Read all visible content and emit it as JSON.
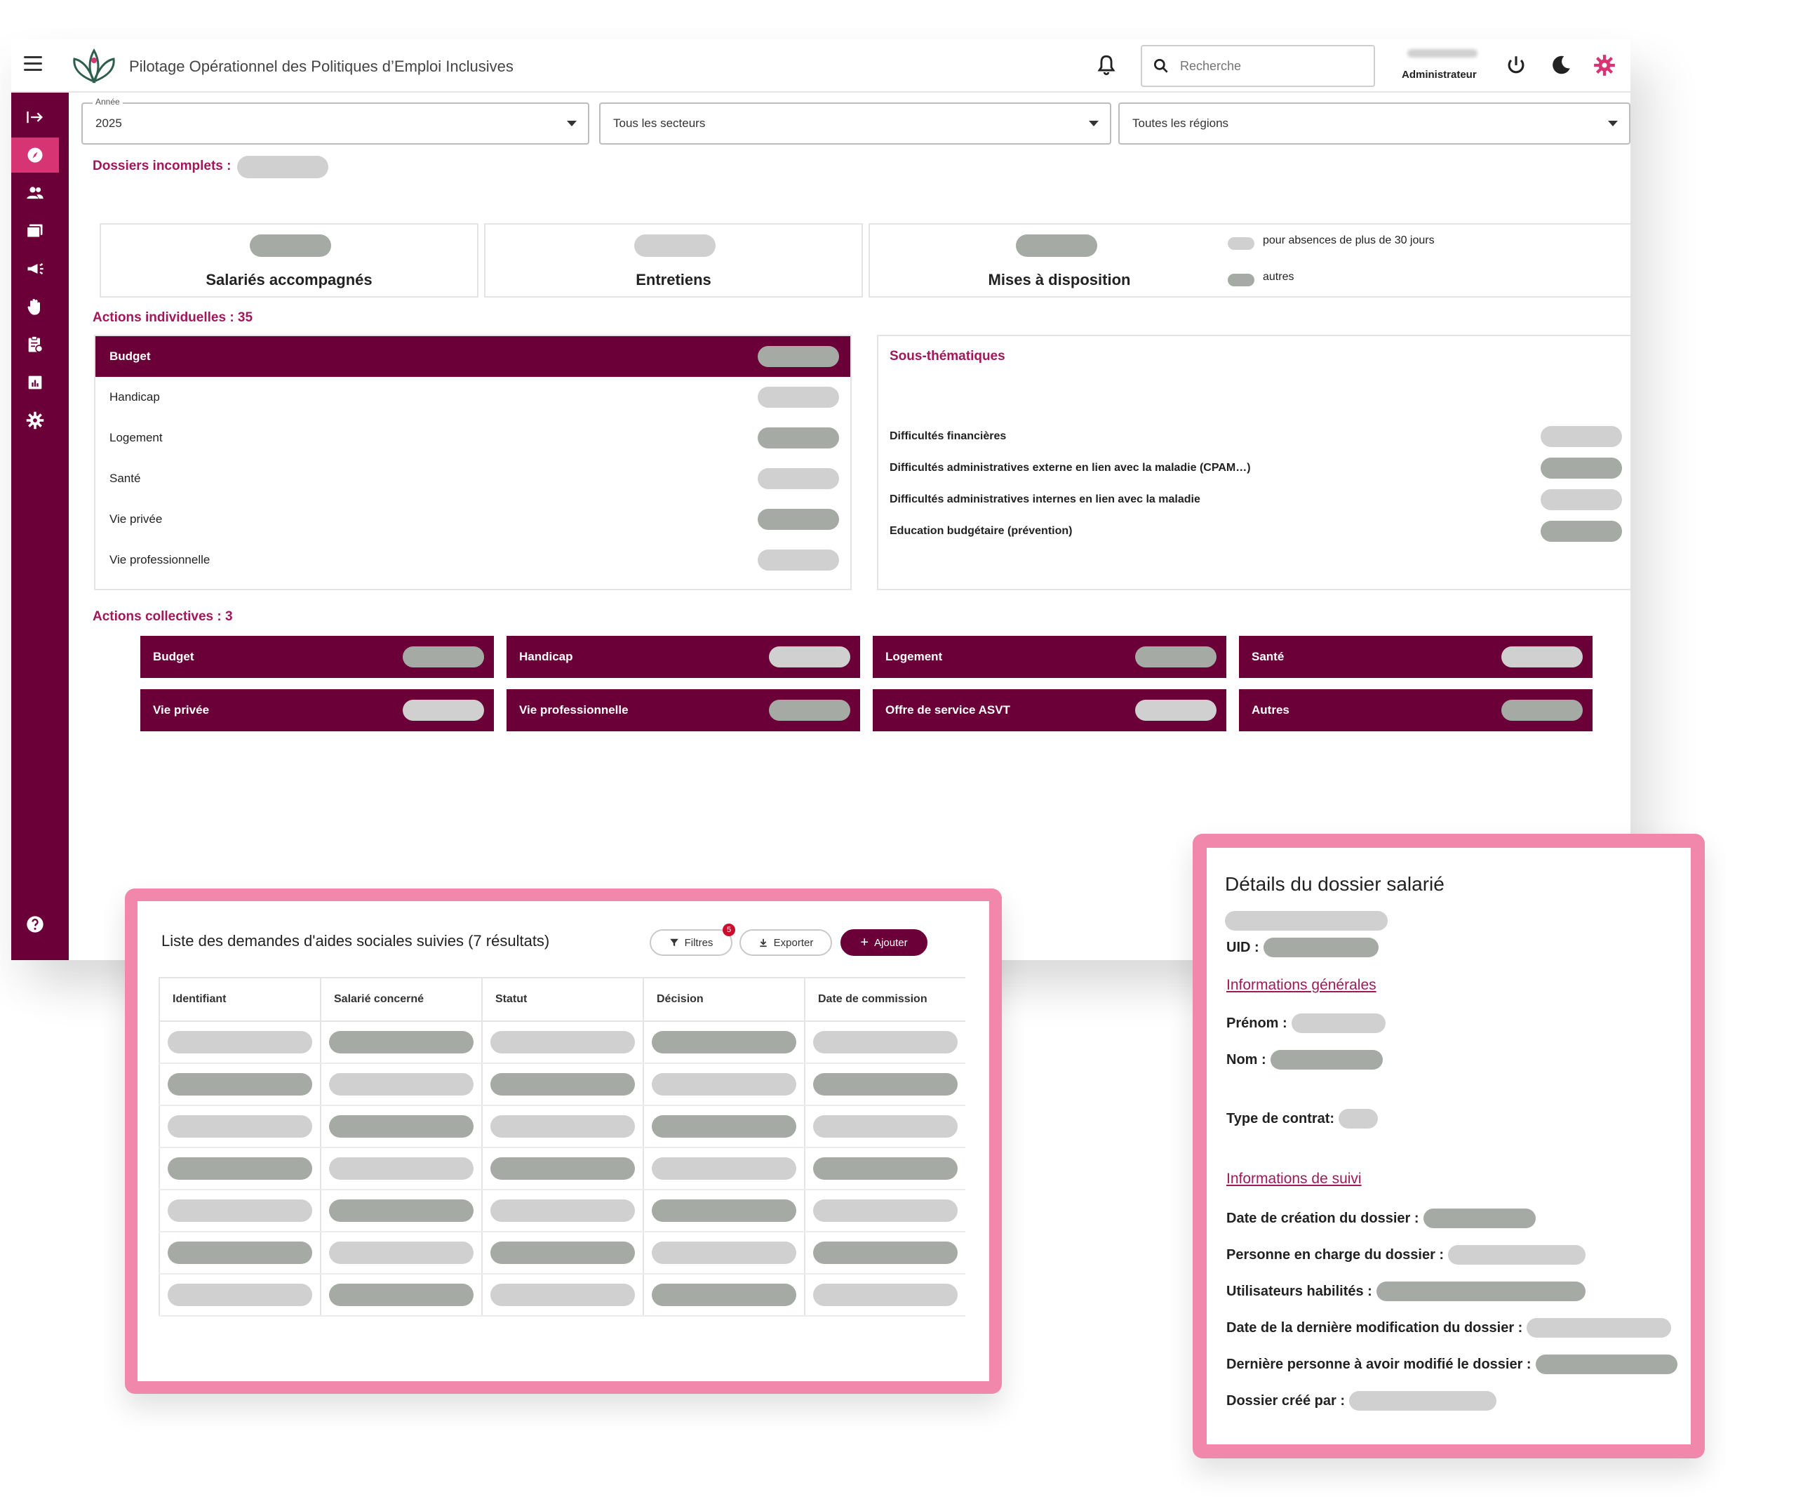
{
  "header": {
    "app_title": "Pilotage Opérationnel des Politiques d’Emploi Inclusives",
    "search_placeholder": "Recherche",
    "user_role": "Administrateur"
  },
  "colors": {
    "primary": "#6b0038",
    "accent": "#d63472",
    "highlight": "#f287ac",
    "link": "#a0185a"
  },
  "icons": {
    "topbar": [
      "menu-icon",
      "logo-icon",
      "bell-icon",
      "search-icon",
      "power-icon",
      "moon-icon",
      "gear-icon"
    ],
    "sidebar": [
      "expand-icon",
      "compass-icon",
      "users-icon",
      "folders-icon",
      "megaphone-icon",
      "hand-icon",
      "clipboard-icon",
      "chart-icon",
      "settings-icon",
      "help-icon"
    ]
  },
  "filters": {
    "year_label": "Année",
    "year_value": "2025",
    "sector_value": "Tous les secteurs",
    "region_value": "Toutes les régions"
  },
  "incomplete": {
    "label": "Dossiers incomplets  :"
  },
  "kpis": {
    "salaries": "Salariés accompagnés",
    "entretiens": "Entretiens",
    "mises": "Mises à disposition",
    "legend_absence": "pour absences de plus de 30 jours",
    "legend_other": "autres"
  },
  "individual": {
    "title": "Actions individuelles  : 35",
    "items": [
      "Budget",
      "Handicap",
      "Logement",
      "Santé",
      "Vie privée",
      "Vie professionnelle"
    ],
    "active_index": 0
  },
  "subthemes": {
    "title": "Sous-thématiques",
    "items": [
      "Difficultés financières",
      "Difficultés administratives externe en lien avec la maladie (CPAM…)",
      "Difficultés administratives internes en lien avec la maladie",
      "Education budgétaire (prévention)"
    ]
  },
  "collective": {
    "title": "Actions collectives  : 3",
    "items": [
      "Budget",
      "Handicap",
      "Logement",
      "Santé",
      "Vie privée",
      "Vie professionnelle",
      "Offre de service ASVT",
      "Autres"
    ]
  },
  "list": {
    "title": "Liste des demandes d'aides sociales suivies (7 résultats)",
    "filters_label": "Filtres",
    "filters_badge": "5",
    "export_label": "Exporter",
    "add_label": "Ajouter",
    "columns": [
      "Identifiant",
      "Salarié concerné",
      "Statut",
      "Décision",
      "Date de commission"
    ]
  },
  "detail": {
    "title": "Détails du dossier salarié",
    "uid_label": "UID :",
    "general_link": "Informations générales",
    "prenom_label": "Prénom :",
    "nom_label": "Nom :",
    "contrat_label": "Type de contrat:",
    "suivi_link": "Informations de suivi",
    "creation_label": "Date de création du dossier :",
    "charge_label": "Personne en charge du dossier :",
    "users_label": "Utilisateurs habilités :",
    "lastmod_label": "Date de la dernière modification du dossier :",
    "lastperson_label": "Dernière personne à avoir modifié le dossier :",
    "createdby_label": "Dossier créé par :"
  }
}
